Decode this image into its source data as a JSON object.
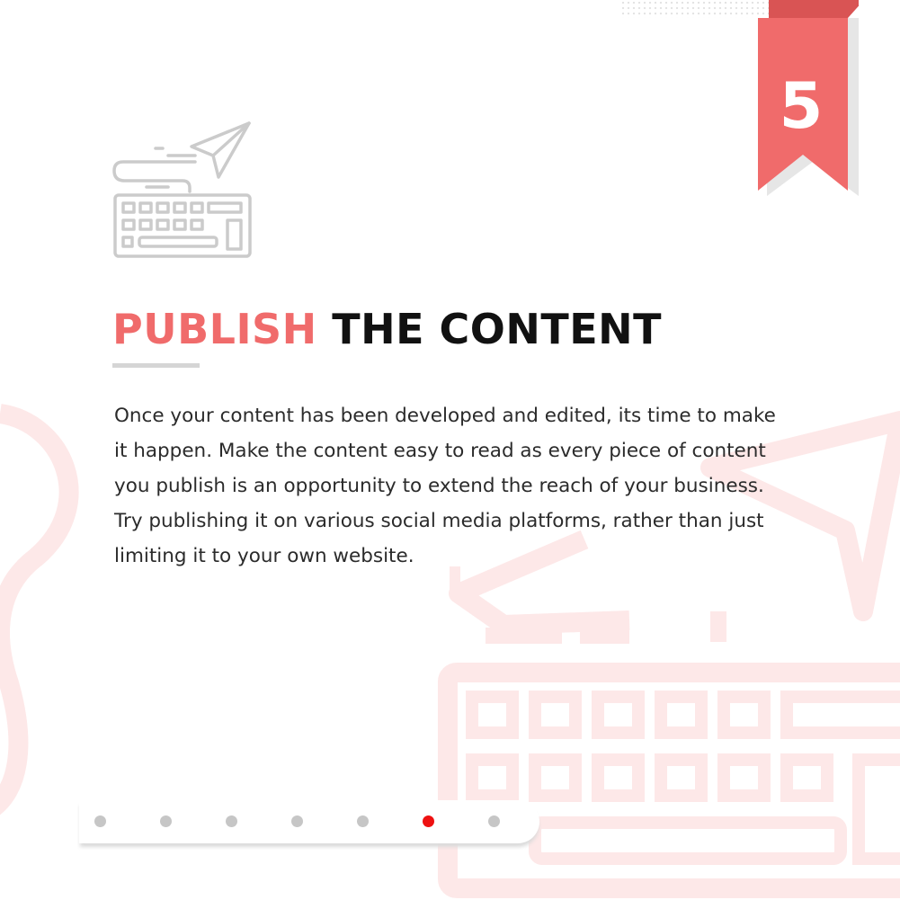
{
  "step": {
    "number": "5"
  },
  "heading": {
    "accent": "PUBLISH",
    "rest": "THE CONTENT"
  },
  "body": "Once your content has been developed and edited, its time to make it happen. Make the content easy to read as every piece of content you publish is an opportunity to extend the reach of your business. Try publishing it on various social media platforms, rather than just limiting it to your own website.",
  "pagination": {
    "total": 7,
    "active_index": 5
  },
  "colors": {
    "accent": "#f06b6b",
    "ribbon_shadow": "#e6e6e6",
    "active_dot": "#ee1111",
    "inactive_dot": "#c6c6c6",
    "faint_art": "#fde8e8"
  },
  "icons": {
    "main": "keyboard-paper-plane-icon"
  }
}
